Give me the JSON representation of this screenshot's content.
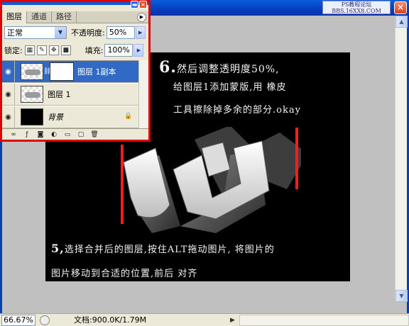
{
  "watermark": {
    "line1": "PS教程论坛",
    "line2": "BBS.16XX8.COM"
  },
  "doc_window": {
    "close_glyph": "×"
  },
  "panel": {
    "tabs": [
      {
        "label": "图层"
      },
      {
        "label": "通道"
      },
      {
        "label": "路径"
      }
    ],
    "blend_mode": "正常",
    "opacity_label": "不透明度:",
    "opacity_value": "50%",
    "lock_label": "锁定:",
    "fill_label": "填充:",
    "fill_value": "100%",
    "layers": [
      {
        "name": "图层 1副本",
        "selected": true
      },
      {
        "name": "图层 1",
        "selected": false
      },
      {
        "name": "背景",
        "selected": false
      }
    ]
  },
  "canvas": {
    "step6": {
      "number": "6.",
      "line1": "然后调整透明度50%,",
      "line2": "给图层1添加蒙版,用 橡皮",
      "line3": "工具擦除掉多余的部分.okay"
    },
    "step5": {
      "number": "5,",
      "line1": "选择合并后的图层,按住ALT拖动图片, 将图片的",
      "line2": "图片移动到合适的位置,前后 对齐"
    }
  },
  "status": {
    "zoom": "66.67%",
    "doc_info": "文档:900.0K/1.79M"
  },
  "colors": {
    "accent_red": "#e00000",
    "titlebar_blue": "#0341c0",
    "selected_layer": "#316ac5"
  }
}
